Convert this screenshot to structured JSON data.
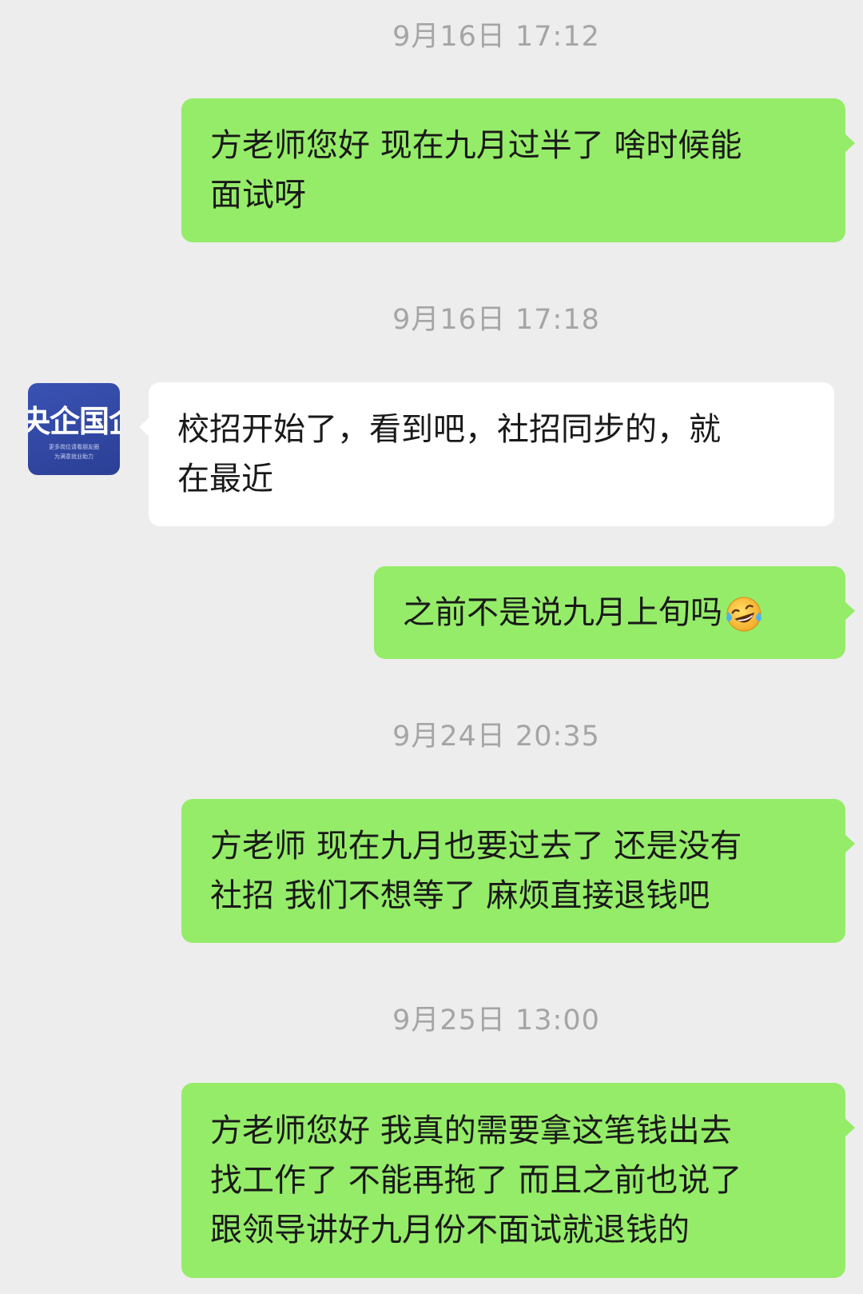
{
  "chat": {
    "timestamps": [
      "9月16日 17:12",
      "9月16日 17:18",
      "9月24日 20:35",
      "9月25日 13:00"
    ],
    "messages": [
      {
        "side": "outgoing",
        "lines": [
          "方老师您好 现在九月过半了 啥时候能",
          "面试呀"
        ]
      },
      {
        "side": "incoming",
        "lines": [
          "校招开始了，看到吧，社招同步的，就",
          "在最近"
        ]
      },
      {
        "side": "outgoing",
        "lines": [
          "之前不是说九月上旬吗"
        ],
        "emoji": "laughing-crying-emoji"
      },
      {
        "side": "outgoing",
        "lines": [
          "方老师 现在九月也要过去了 还是没有",
          "社招 我们不想等了 麻烦直接退钱吧"
        ]
      },
      {
        "side": "outgoing",
        "lines": [
          "方老师您好 我真的需要拿这笔钱出去",
          "找工作了 不能再拖了 而且之前也说了",
          "跟领导讲好九月份不面试就退钱的"
        ]
      }
    ]
  },
  "contact_avatar": {
    "logo_text": "央企国企",
    "sub_line_1": "更多岗位请看朋友圈",
    "sub_line_2": "为满意就业助力",
    "bg_color": "#2f46a3"
  },
  "colors": {
    "background": "#ededed",
    "outgoing_bubble": "#95ec69",
    "incoming_bubble": "#ffffff",
    "timestamp_text": "#a5a5a5"
  }
}
